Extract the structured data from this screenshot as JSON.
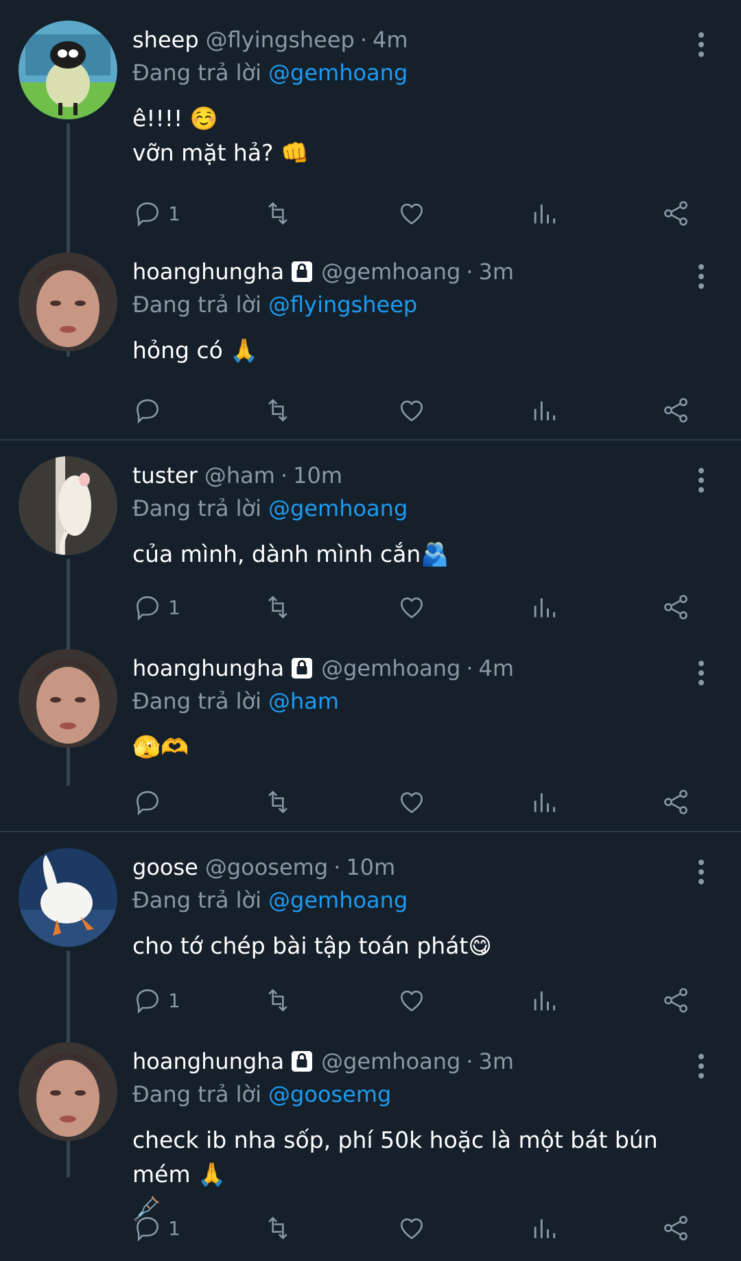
{
  "colors": {
    "background": "#15202b",
    "text": "#ffffff",
    "muted": "#8b98a5",
    "link": "#1d9bf0",
    "line": "#38444d"
  },
  "tweets": [
    {
      "display_name": "sheep",
      "handle": "@flyingsheep",
      "separator": "·",
      "time": "4m",
      "reply_prefix": "Đang trả lời",
      "reply_to": "@gemhoang",
      "text": "ê!!!! ☺️\nvỡn mặt hả? 👊",
      "reply_count": "1",
      "locked": false,
      "avatar": "sheep-avatar"
    },
    {
      "display_name": "hoanghungha",
      "handle": "@gemhoang",
      "separator": "·",
      "time": "3m",
      "reply_prefix": "Đang trả lời",
      "reply_to": "@flyingsheep",
      "text": "hỏng có 🙏",
      "reply_count": "",
      "locked": true,
      "avatar": "person-avatar"
    },
    {
      "display_name": "tuster",
      "handle": "@ham",
      "separator": "·",
      "time": "10m",
      "reply_prefix": "Đang trả lời",
      "reply_to": "@gemhoang",
      "text": "của mình, dành mình cắn🫂",
      "reply_count": "1",
      "locked": false,
      "avatar": "mouse-avatar"
    },
    {
      "display_name": "hoanghungha",
      "handle": "@gemhoang",
      "separator": "·",
      "time": "4m",
      "reply_prefix": "Đang trả lời",
      "reply_to": "@ham",
      "text": "🫣🫶",
      "reply_count": "",
      "locked": true,
      "avatar": "person-avatar"
    },
    {
      "display_name": "goose",
      "handle": "@goosemg",
      "separator": "·",
      "time": "10m",
      "reply_prefix": "Đang trả lời",
      "reply_to": "@gemhoang",
      "text": "cho tớ chép bài tập toán phát😋",
      "reply_count": "1",
      "locked": false,
      "avatar": "goose-avatar"
    },
    {
      "display_name": "hoanghungha",
      "handle": "@gemhoang",
      "separator": "·",
      "time": "3m",
      "reply_prefix": "Đang trả lời",
      "reply_to": "@goosemg",
      "text": "check ib nha sốp, phí 50k hoặc là một bát bún mém 🙏\n🩼",
      "reply_count": "1",
      "locked": true,
      "avatar": "person-avatar"
    }
  ]
}
